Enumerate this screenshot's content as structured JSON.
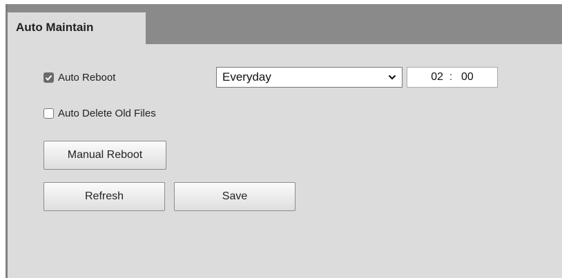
{
  "tab": {
    "label": "Auto Maintain"
  },
  "auto_reboot": {
    "label": "Auto Reboot",
    "checked": true,
    "schedule": "Everyday",
    "hour": "02",
    "separator": ":",
    "minute": "00"
  },
  "auto_delete": {
    "label": "Auto Delete Old Files",
    "checked": false
  },
  "buttons": {
    "manual_reboot": "Manual Reboot",
    "refresh": "Refresh",
    "save": "Save"
  },
  "colors": {
    "panel": "#dcdcdc",
    "tab_bar": "#8a8a8a",
    "checkbox_checked": "#6b6b6b"
  }
}
